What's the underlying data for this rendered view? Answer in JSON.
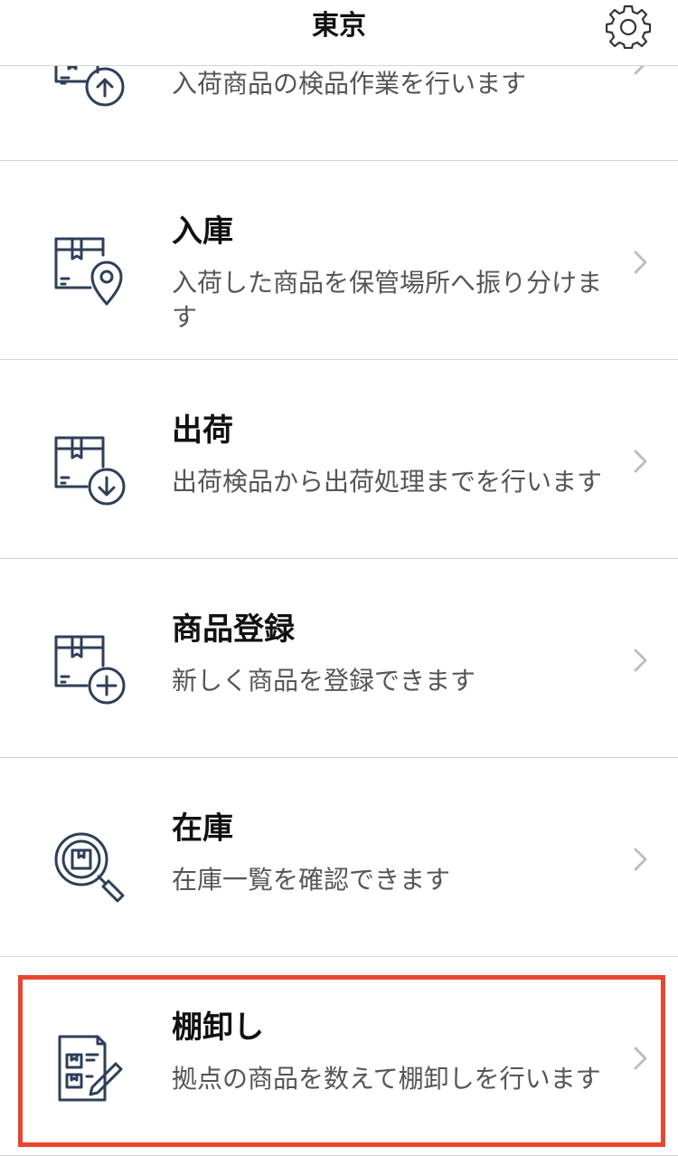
{
  "header": {
    "title": "東京",
    "settings_icon": "gear-icon"
  },
  "menu": [
    {
      "id": "inspection",
      "title": "",
      "description": "入荷商品の検品作業を行います",
      "icon": "box-upload-icon"
    },
    {
      "id": "putaway",
      "title": "入庫",
      "description": "入荷した商品を保管場所へ振り分けます",
      "icon": "box-location-icon"
    },
    {
      "id": "shipping",
      "title": "出荷",
      "description": "出荷検品から出荷処理までを行います",
      "icon": "box-download-icon"
    },
    {
      "id": "register",
      "title": "商品登録",
      "description": "新しく商品を登録できます",
      "icon": "box-add-icon"
    },
    {
      "id": "stock",
      "title": "在庫",
      "description": "在庫一覧を確認できます",
      "icon": "magnifier-box-icon"
    },
    {
      "id": "stocktake",
      "title": "棚卸し",
      "description": "拠点の商品を数えて棚卸しを行います",
      "icon": "clipboard-pencil-icon"
    }
  ],
  "colors": {
    "icon_stroke": "#2e3f57",
    "highlight": "#e8462d",
    "chevron": "#bdbdbd",
    "divider": "#d4d4d4"
  }
}
